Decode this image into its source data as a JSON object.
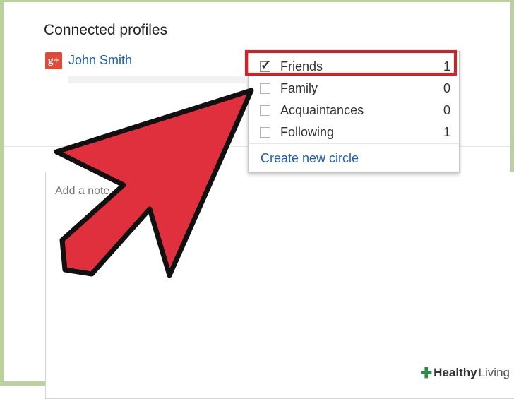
{
  "page": {
    "title": "Connected profiles",
    "gplus_logo": "g+",
    "profile_name": "John Smith",
    "note_placeholder": "Add a note"
  },
  "circles_dropdown": {
    "items": [
      {
        "label": "Friends",
        "count": "1",
        "checked": true,
        "highlighted": true
      },
      {
        "label": "Family",
        "count": "0",
        "checked": false
      },
      {
        "label": "Acquaintances",
        "count": "0",
        "checked": false
      },
      {
        "label": "Following",
        "count": "1",
        "checked": false
      }
    ],
    "create_link": "Create new circle"
  },
  "watermark": {
    "icon": "plus-logo-icon",
    "bold": "Healthy",
    "light": "Living"
  },
  "colors": {
    "arrow_fill": "#e0303e",
    "highlight_border": "#e21b23",
    "link": "#1a5fb4",
    "gplus": "#dd4b39",
    "frame": "#b9d39a"
  }
}
